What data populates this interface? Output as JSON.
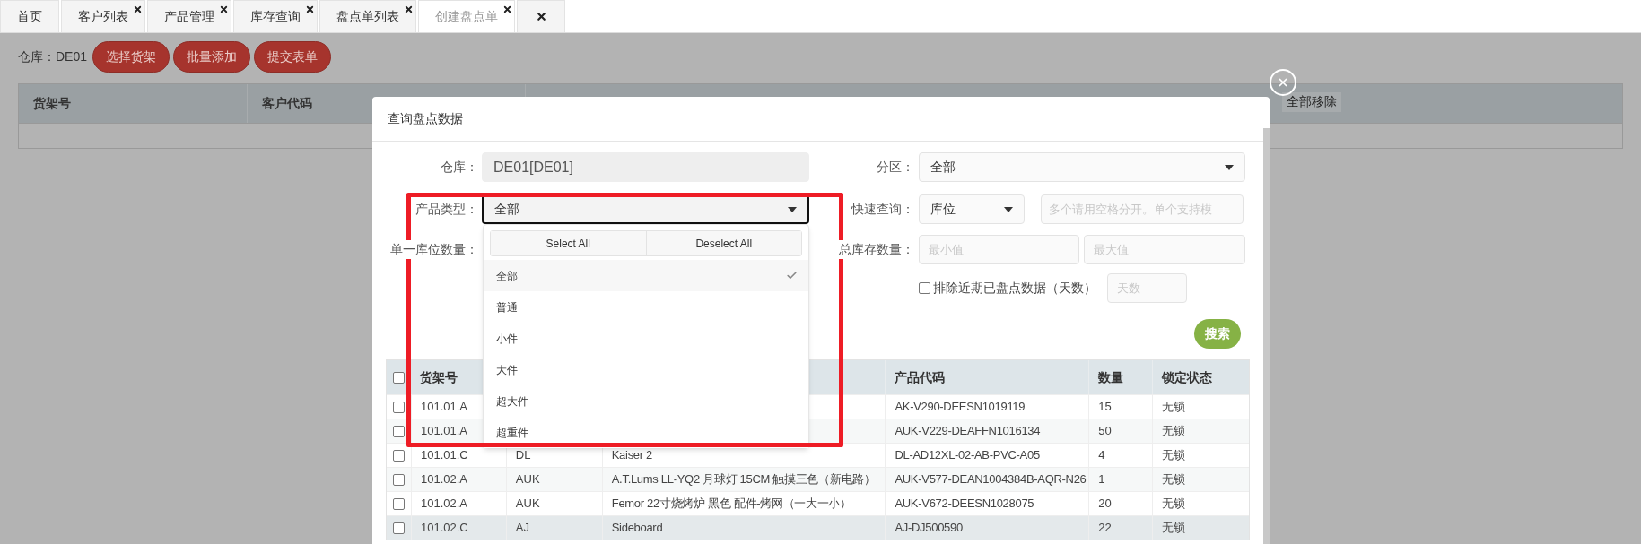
{
  "tabs": [
    {
      "kind": "page",
      "label": "首页",
      "closable": false,
      "selected": false
    },
    {
      "kind": "page",
      "label": "客户列表",
      "closable": true,
      "selected": false
    },
    {
      "kind": "page",
      "label": "产品管理",
      "closable": true,
      "selected": false
    },
    {
      "kind": "page",
      "label": "库存查询",
      "closable": true,
      "selected": false
    },
    {
      "kind": "page",
      "label": "盘点单列表",
      "closable": true,
      "selected": false
    },
    {
      "kind": "page",
      "label": "创建盘点单",
      "closable": true,
      "selected": true
    },
    {
      "kind": "close-all"
    }
  ],
  "toolbar": {
    "warehouse_label": "仓库：",
    "warehouse": "DE01",
    "buttons": [
      "选择货架",
      "批量添加",
      "提交表单"
    ]
  },
  "background_table": {
    "columns": [
      "货架号",
      "客户代码"
    ],
    "action": "全部移除"
  },
  "dialog": {
    "title": "查询盘点数据",
    "form": {
      "warehouse": {
        "label": "仓库：",
        "value": "DE01[DE01]"
      },
      "zone": {
        "label": "分区：",
        "value": "全部"
      },
      "product_type": {
        "label": "产品类型：",
        "value": "全部",
        "expanded": true
      },
      "quick_search": {
        "label": "快速查询：",
        "field": "库位",
        "placeholder": "多个请用空格分开。单个支持模"
      },
      "single_qty": {
        "label": "单一库位数量："
      },
      "total_qty": {
        "label": "总库存数量：",
        "min_placeholder": "最小值",
        "max_placeholder": "最大值"
      },
      "exclude_recent": {
        "label": "排除近期已盘点数据（天数）",
        "checked": false,
        "placeholder": "天数"
      },
      "search_button": "搜索"
    },
    "dropdown": {
      "select_all": "Select All",
      "deselect_all": "Deselect All",
      "options": [
        {
          "label": "全部",
          "selected": true
        },
        {
          "label": "普通",
          "selected": false
        },
        {
          "label": "小件",
          "selected": false
        },
        {
          "label": "大件",
          "selected": false
        },
        {
          "label": "超大件",
          "selected": false
        },
        {
          "label": "超重件",
          "selected": false
        }
      ]
    },
    "table": {
      "all_checked": false,
      "columns": {
        "shelf": "货架号",
        "product_code": "产品代码",
        "quantity": "数量",
        "lock_status": "锁定状态"
      },
      "rows": [
        {
          "checked": false,
          "highlighted": false,
          "shelf": "101.01.A",
          "product_code": "AK-V290-DEESN1019119",
          "quantity": "15",
          "lock_status": "无锁"
        },
        {
          "checked": false,
          "highlighted": false,
          "shelf": "101.01.A",
          "product_code": "AUK-V229-DEAFFN1016134",
          "quantity": "50",
          "lock_status": "无锁"
        },
        {
          "checked": false,
          "highlighted": false,
          "shelf": "101.01.C",
          "customer": "DL",
          "name": "Kaiser 2",
          "product_code": "DL-AD12XL-02-AB-PVC-A05",
          "quantity": "4",
          "lock_status": "无锁"
        },
        {
          "checked": false,
          "highlighted": false,
          "shelf": "101.02.A",
          "customer": "AUK",
          "name": "A.T.Lums LL-YQ2 月球灯 15CM 触摸三色（新电路）",
          "product_code": "AUK-V577-DEAN1004384B-AQR-N26",
          "quantity": "1",
          "lock_status": "无锁"
        },
        {
          "checked": false,
          "highlighted": false,
          "shelf": "101.02.A",
          "customer": "AUK",
          "name": "Femor 22寸烧烤炉 黑色 配件-烤网（一大一小）",
          "product_code": "AUK-V672-DEESN1028075",
          "quantity": "20",
          "lock_status": "无锁"
        },
        {
          "checked": false,
          "highlighted": true,
          "shelf": "101.02.C",
          "customer": "AJ",
          "name": "Sideboard",
          "product_code": "AJ-DJ500590",
          "quantity": "22",
          "lock_status": "无锁"
        }
      ]
    }
  }
}
